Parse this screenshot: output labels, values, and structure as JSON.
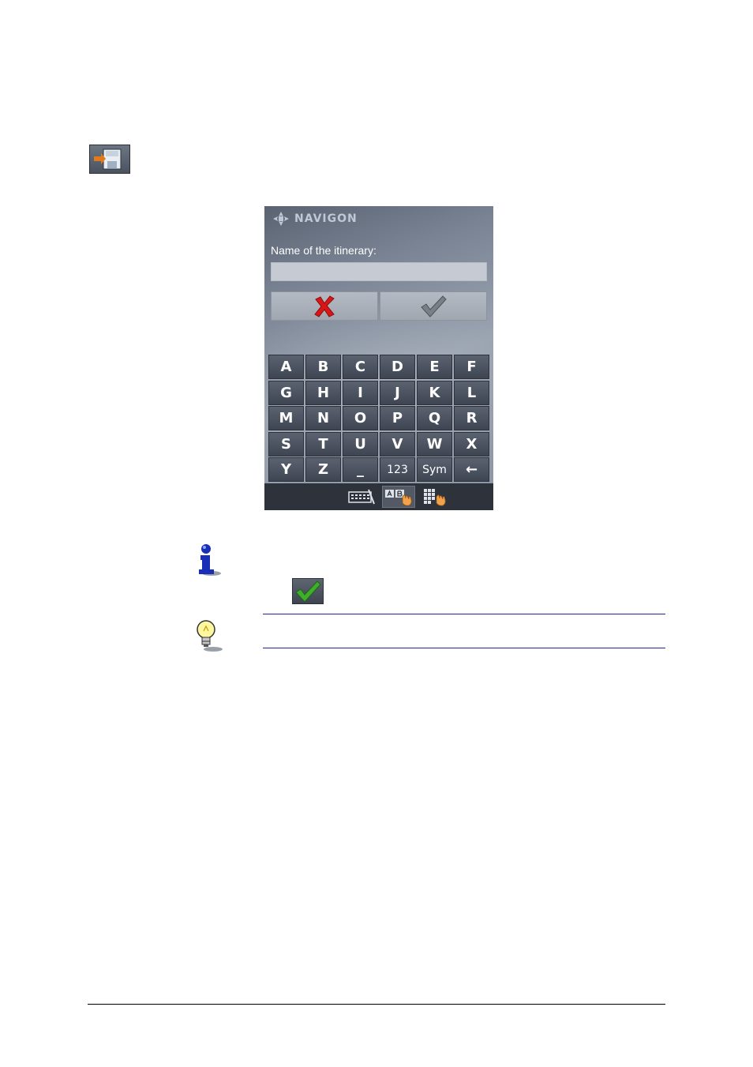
{
  "save_icon": {
    "icon": "save-itinerary-icon"
  },
  "device": {
    "brand": "NAVIGON",
    "field_label": "Name of the itinerary:",
    "name_input": {
      "value": "",
      "placeholder": ""
    },
    "cancel_icon": "cross-icon",
    "ok_icon": "checkmark-icon",
    "keyboard": {
      "rows": [
        [
          "A",
          "B",
          "C",
          "D",
          "E",
          "F"
        ],
        [
          "G",
          "H",
          "I",
          "J",
          "K",
          "L"
        ],
        [
          "M",
          "N",
          "O",
          "P",
          "Q",
          "R"
        ],
        [
          "S",
          "T",
          "U",
          "V",
          "W",
          "X"
        ],
        [
          "Y",
          "Z",
          "_",
          "123",
          "Sym",
          "←"
        ]
      ]
    },
    "mode_buttons": [
      "keyboard-layout-icon",
      "abc-keyboard-icon",
      "numeric-keypad-icon"
    ]
  },
  "colors": {
    "accent_blue": "#2323a8",
    "cancel_red": "#d81616",
    "ok_green": "#3fae2a"
  }
}
